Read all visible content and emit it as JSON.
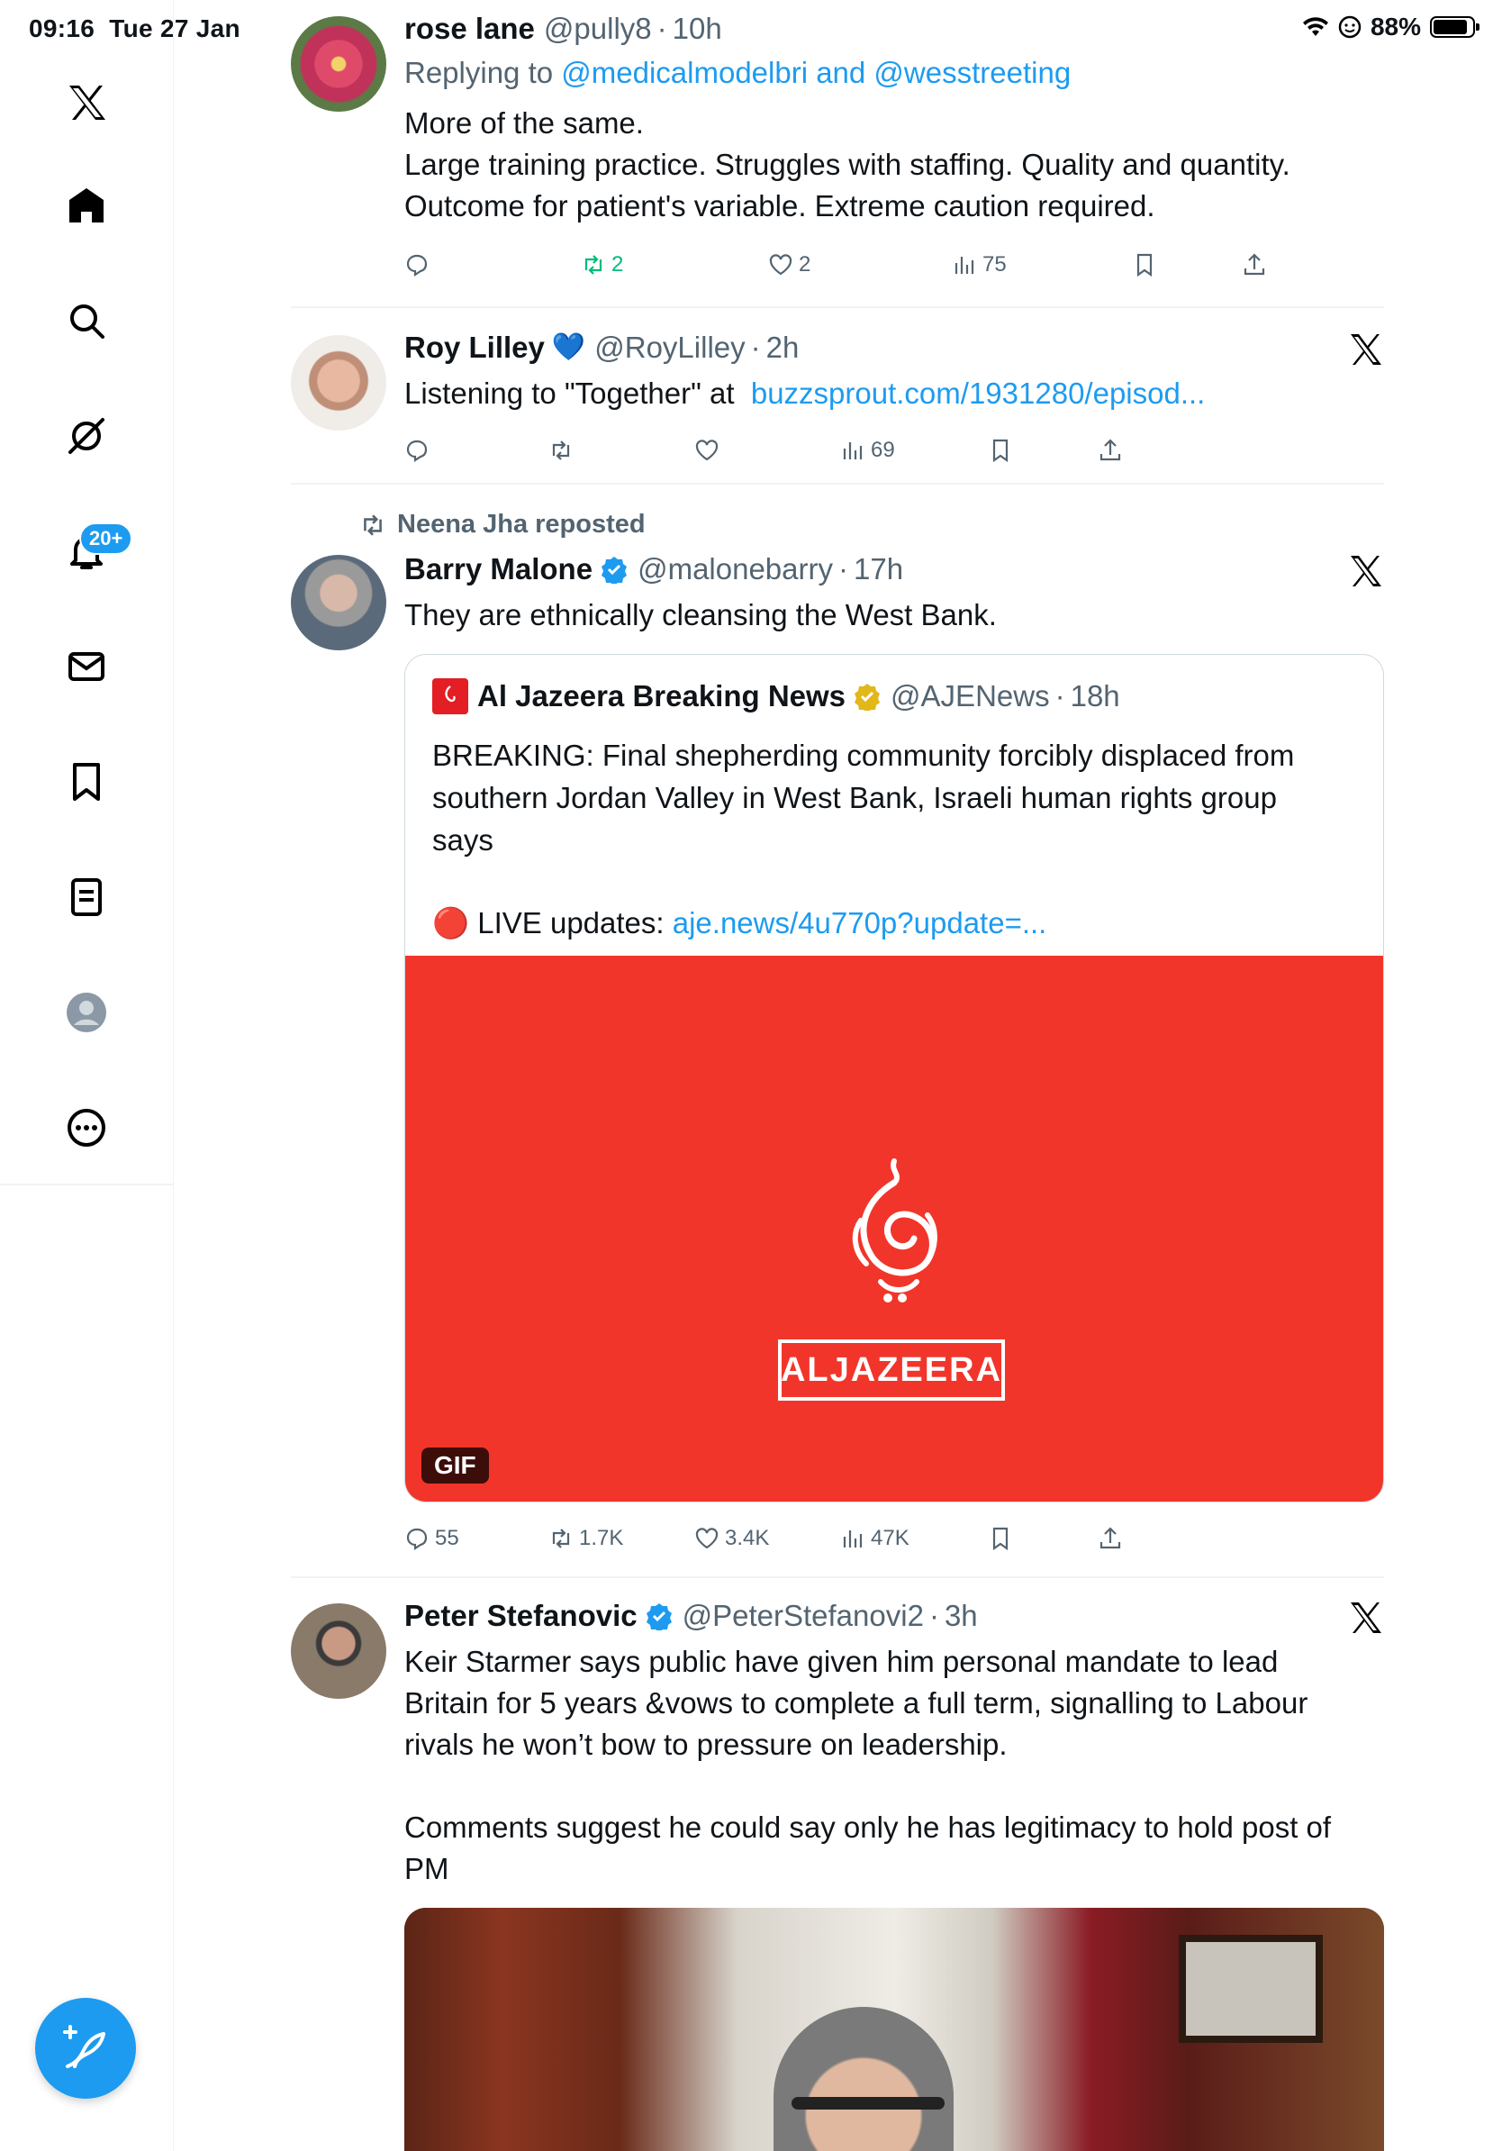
{
  "status_bar": {
    "time": "09:16",
    "date": "Tue 27 Jan",
    "battery": "88%",
    "battery_level": 0.88
  },
  "sidebar": {
    "notifications_badge": "20+",
    "items": [
      "x-logo",
      "home",
      "search",
      "grok",
      "notifications",
      "messages",
      "bookmarks",
      "lists",
      "profile",
      "more"
    ]
  },
  "tweets": [
    {
      "name": "rose lane",
      "handle": "@pully8",
      "time": "10h",
      "replying_prefix": "Replying to ",
      "replying_to": "@medicalmodelbri and @wesstreeting",
      "text_lines": [
        "More of the same.",
        "Large training practice. Struggles with staffing. Quality and quantity.",
        "Outcome for patient's variable. Extreme caution required."
      ],
      "retweets": "2",
      "likes": "2",
      "views": "75"
    },
    {
      "name": "Roy Lilley",
      "emoji": "💙",
      "handle": "@RoyLilley",
      "time": "2h",
      "text": "Listening to \"Together\" at",
      "link": "buzzsprout.com/1931280/episod...",
      "views": "69"
    },
    {
      "reposted_by": "Neena Jha reposted",
      "name": "Barry Malone",
      "handle": "@malonebarry",
      "time": "17h",
      "text": "They are ethnically cleansing the West Bank.",
      "quote": {
        "name": "Al Jazeera Breaking News",
        "handle": "@AJENews",
        "time": "18h",
        "text_lines": [
          "BREAKING: Final shepherding community forcibly displaced from",
          "southern Jordan Valley in West Bank, Israeli human rights group",
          "says"
        ],
        "live_prefix": "🔴 LIVE updates: ",
        "live_link": "aje.news/4u770p?update=...",
        "media_wordmark": "ALJAZEERA",
        "media_badge": "GIF"
      },
      "replies": "55",
      "retweets": "1.7K",
      "likes": "3.4K",
      "views": "47K"
    },
    {
      "name": "Peter Stefanovic",
      "handle": "@PeterStefanovi2",
      "time": "3h",
      "text_lines": [
        "Keir Starmer says public have given him personal mandate to lead",
        "Britain for 5 years &vows to complete a full term, signalling to Labour",
        "rivals he won’t bow to pressure on leadership."
      ],
      "text_lines_2": [
        "Comments suggest he could say only he has legitimacy to hold post of",
        "PM"
      ]
    }
  ],
  "colors": {
    "accent": "#1d9bf0",
    "retweet_green": "#00ba7c",
    "secondary_text": "#536471",
    "aljazeera_red": "#f2352a"
  }
}
